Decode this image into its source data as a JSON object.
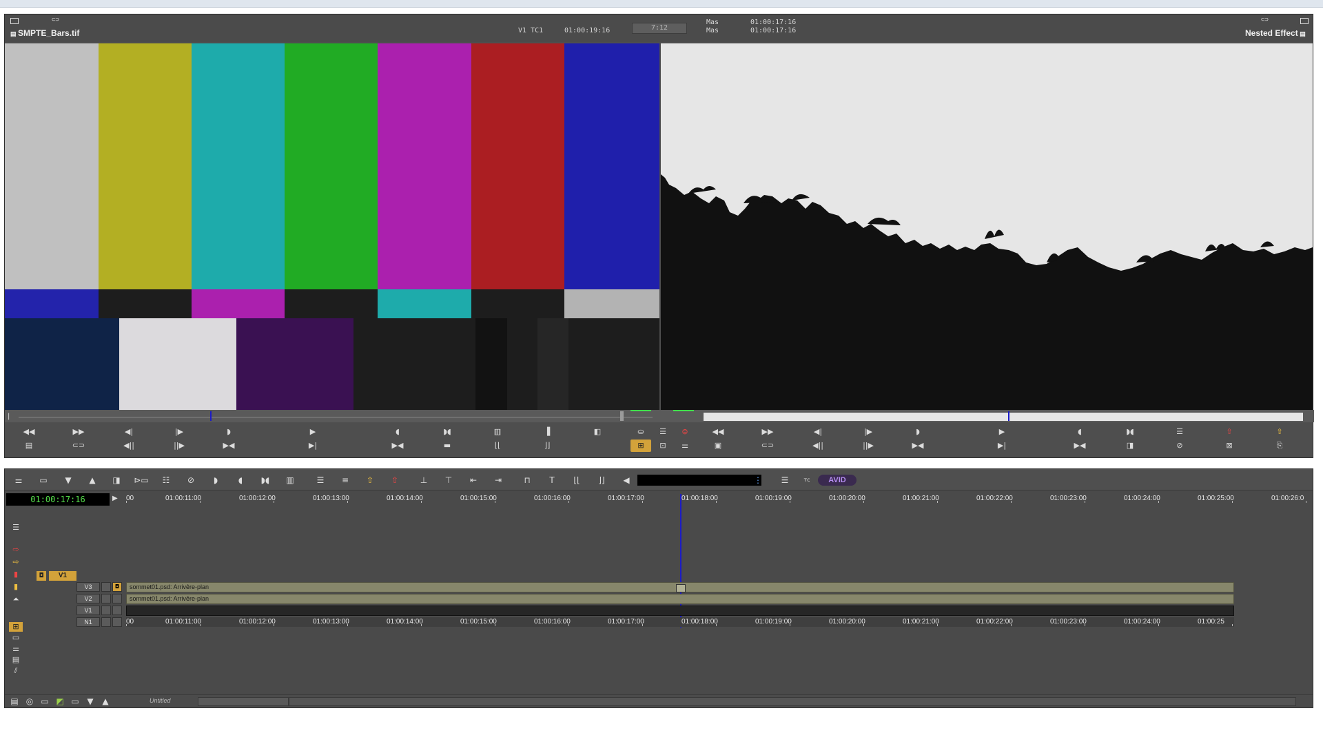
{
  "composer": {
    "source_title": "SMPTE_Bars.tif",
    "source_track_label": "V1 TC1",
    "source_timecode": "01:00:19:16",
    "center_readout": "7:12",
    "mas_label_1": "Mas",
    "mas_label_2": "Mas",
    "record_timecode_1": "01:00:17:16",
    "record_timecode_2": "01:00:17:16",
    "record_title": "Nested Effect"
  },
  "timeline": {
    "timecode": "01:00:17:16",
    "ruler_labels": [
      "00",
      "01:00:11:00",
      "01:00:12:00",
      "01:00:13:00",
      "01:00:14:00",
      "01:00:15:00",
      "01:00:16:00",
      "01:00:17:00",
      "01:00:18:00",
      "01:00:19:00",
      "01:00:20:00",
      "01:00:21:00",
      "01:00:22:00",
      "01:00:23:00",
      "01:00:24:00",
      "01:00:25:00",
      "01:00:26:0"
    ],
    "bottom_ruler_labels": [
      "00",
      "01:00:11:00",
      "01:00:12:00",
      "01:00:13:00",
      "01:00:14:00",
      "01:00:15:00",
      "01:00:16:00",
      "01:00:17:00",
      "01:00:18:00",
      "01:00:19:00",
      "01:00:20:00",
      "01:00:21:00",
      "01:00:22:00",
      "01:00:23:00",
      "01:00:24:00",
      "01:00:25"
    ],
    "source_track": "V1",
    "tracks": [
      {
        "label": "V3",
        "clip": "sommet01.psd: Arrivêre-plan"
      },
      {
        "label": "V2",
        "clip": "sommet01.psd: Arrivêre-plan"
      },
      {
        "label": "V1",
        "clip": ""
      },
      {
        "label": "N1",
        "clip": ""
      }
    ],
    "bottom_label": "Untitled",
    "logo": "AVID"
  },
  "colors": {
    "accent": "#d3a23a",
    "timecode_green": "#55e04a",
    "playhead": "#1c1cc8",
    "clip": "#87876b"
  }
}
